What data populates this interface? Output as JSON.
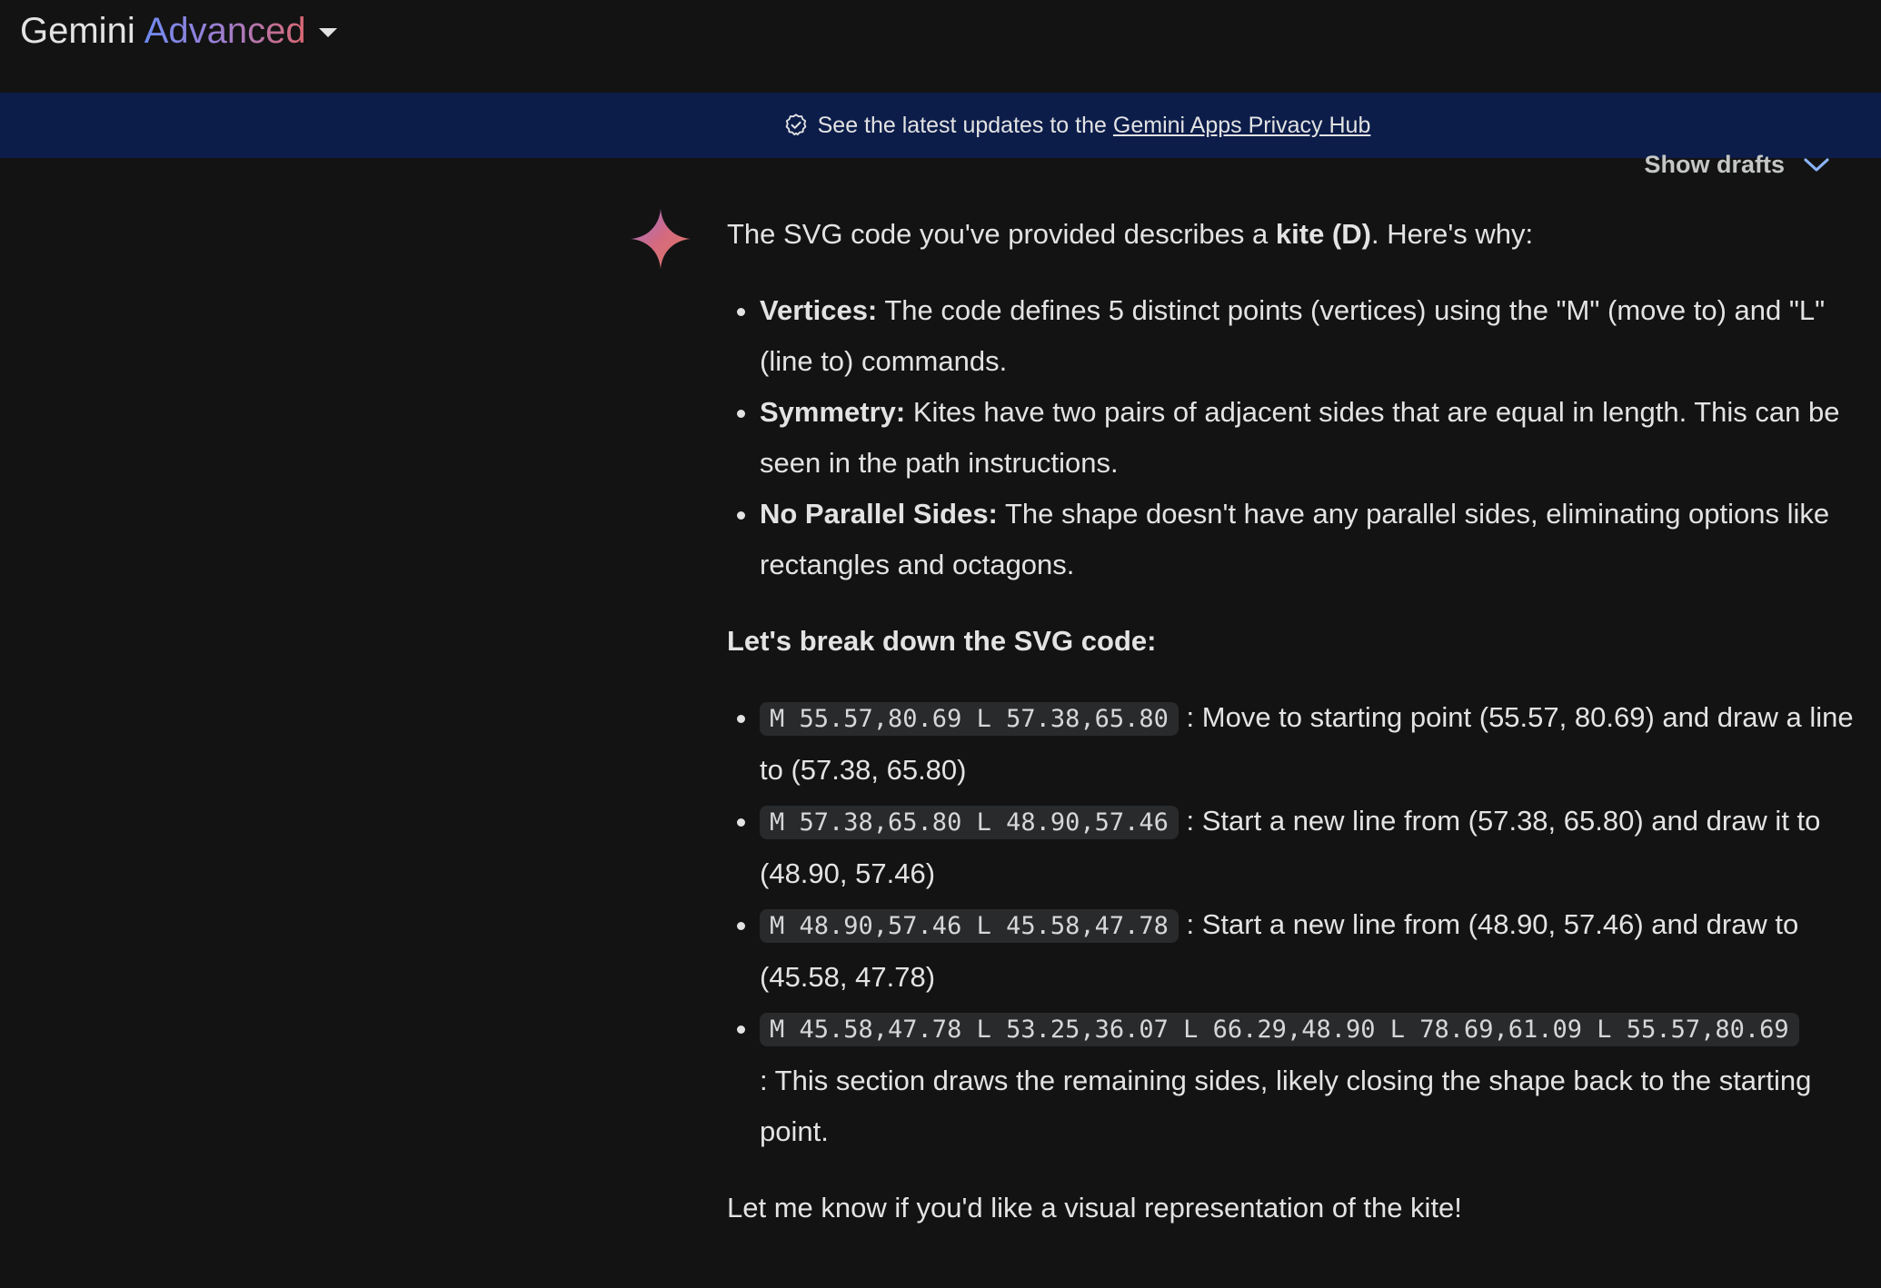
{
  "header": {
    "brand_gemini": "Gemini",
    "brand_advanced": "Advanced"
  },
  "banner": {
    "text": "See the latest updates to the",
    "link": "Gemini Apps Privacy Hub"
  },
  "drafts": {
    "label": "Show drafts"
  },
  "response": {
    "intro_before": "The SVG code you've provided describes a",
    "intro_bold": "kite (D)",
    "intro_after": ". Here's why:",
    "reasons": [
      {
        "label": "Vertices:",
        "text": "The code defines 5 distinct points (vertices) using the \"M\" (move to) and \"L\" (line to) commands."
      },
      {
        "label": "Symmetry:",
        "text": "Kites have two pairs of adjacent sides that are equal in length. This can be seen in the path instructions."
      },
      {
        "label": "No Parallel Sides:",
        "text": "The shape doesn't have any parallel sides, eliminating options like rectangles and octagons."
      }
    ],
    "breakdown_heading": "Let's break down the SVG code:",
    "steps": [
      {
        "code": "M 55.57,80.69 L 57.38,65.80",
        "text": ": Move to starting point (55.57, 80.69) and draw a line to (57.38, 65.80)"
      },
      {
        "code": "M 57.38,65.80 L 48.90,57.46",
        "text": ": Start a new line from (57.38, 65.80) and draw it to (48.90, 57.46)"
      },
      {
        "code": "M 48.90,57.46 L 45.58,47.78",
        "text": ": Start a new line from (48.90, 57.46) and draw to (45.58, 47.78)"
      },
      {
        "code": "M 45.58,47.78 L 53.25,36.07 L 66.29,48.90 L 78.69,61.09 L 55.57,80.69",
        "text": ": This section draws the remaining sides, likely closing the shape back to the starting point."
      }
    ],
    "closing": "Let me know if you'd like a visual representation of the kite!"
  },
  "icons": {
    "banner_icon": "verified-badge-icon",
    "drafts_icon": "chevron-down-icon",
    "avatar_icon": "gemini-sparkle-icon",
    "model_menu_icon": "caret-down-icon"
  }
}
